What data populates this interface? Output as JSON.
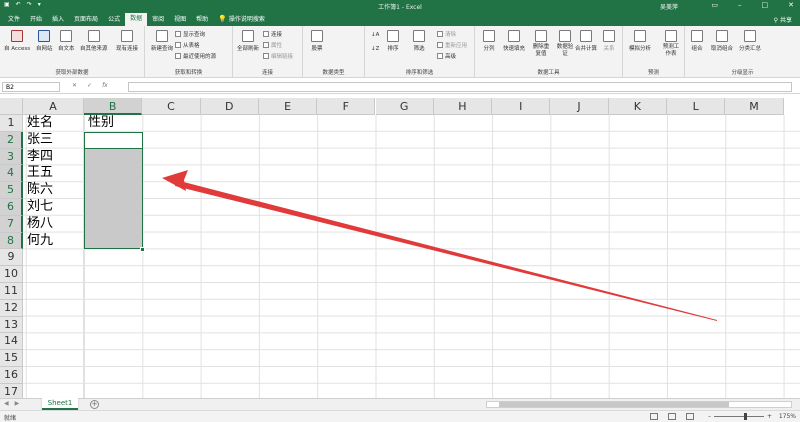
{
  "window": {
    "title": "工作簿1 - Excel",
    "user": "吴美萍",
    "share": "共享",
    "qa_icons": [
      "save-icon",
      "undo-icon",
      "redo-icon",
      "more-icon"
    ],
    "win_controls": [
      "ribbon-display-icon",
      "minimize-icon",
      "restore-icon",
      "close-icon"
    ]
  },
  "tabs": [
    {
      "label": "文件",
      "active": false
    },
    {
      "label": "开始",
      "active": false
    },
    {
      "label": "插入",
      "active": false
    },
    {
      "label": "页面布局",
      "active": false
    },
    {
      "label": "公式",
      "active": false
    },
    {
      "label": "数据",
      "active": true
    },
    {
      "label": "审阅",
      "active": false
    },
    {
      "label": "视图",
      "active": false
    },
    {
      "label": "帮助",
      "active": false
    },
    {
      "label": "操作说明搜索",
      "active": false
    }
  ],
  "ribbon": {
    "groups": {
      "get_external": {
        "label": "获取外部数据",
        "buttons": [
          "自 Access",
          "自网站",
          "自文本",
          "自其他来源",
          "现有连接"
        ]
      },
      "get_transform": {
        "label": "获取和转换",
        "new_query": "新建查询",
        "small": [
          "显示查询",
          "从表格",
          "最近使用的源"
        ]
      },
      "connections": {
        "label": "连接",
        "refresh_all": "全部刷新",
        "small": [
          "连接",
          "属性",
          "编辑链接"
        ]
      },
      "data_types": {
        "label": "数据类型",
        "stocks": "股票"
      },
      "sort_filter": {
        "label": "排序和筛选",
        "sort": "排序",
        "filter": "筛选",
        "small": [
          "清除",
          "重新应用",
          "高级"
        ]
      },
      "data_tools": {
        "label": "数据工具",
        "buttons": [
          "分列",
          "快速填充",
          "删除重复值",
          "数据验证",
          "合并计算",
          "关系"
        ]
      },
      "forecast": {
        "label": "预测",
        "buttons": [
          "模拟分析",
          "预测工作表"
        ]
      },
      "outline": {
        "label": "分级显示",
        "buttons": [
          "组合",
          "取消组合",
          "分类汇总"
        ]
      }
    }
  },
  "formula_bar": {
    "name_box": "B2",
    "cancel": "✕",
    "enter": "✓",
    "fx": "fx",
    "value": ""
  },
  "grid": {
    "columns": [
      "A",
      "B",
      "C",
      "D",
      "E",
      "F",
      "G",
      "H",
      "I",
      "J",
      "K",
      "L",
      "M"
    ],
    "rows": [
      "1",
      "2",
      "3",
      "4",
      "5",
      "6",
      "7",
      "8",
      "9",
      "10",
      "11",
      "12",
      "13",
      "14",
      "15",
      "16",
      "17"
    ],
    "cells": {
      "A1": "姓名",
      "B1": "性别",
      "A2": "张三",
      "A3": "李四",
      "A4": "王五",
      "A5": "陈六",
      "A6": "刘七",
      "A7": "杨八",
      "A8": "何九"
    },
    "selected_range": "B2:B8",
    "active_cell": "B2"
  },
  "colors": {
    "accent": "#217346",
    "arrow": "#e03a3a",
    "selection_fill": "#c9c9c9"
  },
  "sheets": {
    "tabs": [
      "Sheet1"
    ],
    "active": "Sheet1",
    "add_icon": "plus-circle-icon"
  },
  "status": {
    "ready": "就绪",
    "zoom": "175%"
  }
}
